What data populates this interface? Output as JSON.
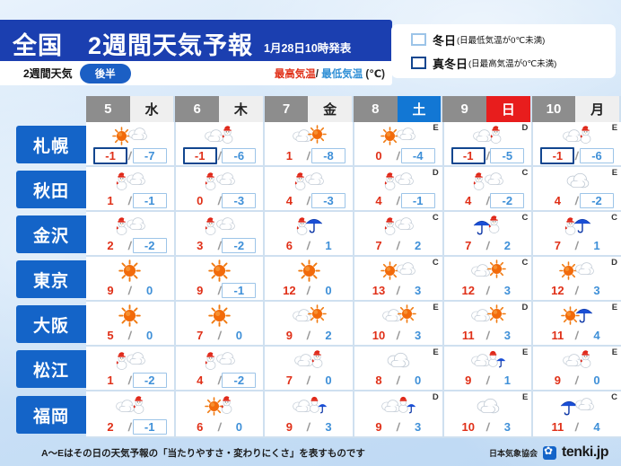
{
  "header": {
    "title": "全国　2週間天気予報",
    "published": "1月28日10時発表",
    "sub_label": "2週間天気",
    "period_pill": "後半",
    "temp_high_label": "最高気温",
    "temp_sep": "/",
    "temp_low_label": "最低気温",
    "temp_unit": "(℃)"
  },
  "legend": {
    "items": [
      {
        "name": "冬日",
        "note": "(日最低気温が0℃未満)",
        "swatch": "light",
        "color": "#9cc4e8"
      },
      {
        "name": "真冬日",
        "note": "(日最高気温が0℃未満)",
        "swatch": "dark",
        "color": "#12468f"
      }
    ]
  },
  "columns": [
    {
      "day": "5",
      "dow": "水",
      "dow_type": "weekday"
    },
    {
      "day": "6",
      "dow": "木",
      "dow_type": "weekday"
    },
    {
      "day": "7",
      "dow": "金",
      "dow_type": "weekday"
    },
    {
      "day": "8",
      "dow": "土",
      "dow_type": "sat"
    },
    {
      "day": "9",
      "dow": "日",
      "dow_type": "sun"
    },
    {
      "day": "10",
      "dow": "月",
      "dow_type": "weekday"
    }
  ],
  "rows": [
    {
      "city": "札幌",
      "cells": [
        {
          "icons": [
            "sun",
            "cloud"
          ],
          "high": "-1",
          "low": "-7",
          "rel": "",
          "high_box": "dark",
          "low_box": "light"
        },
        {
          "icons": [
            "cloud",
            "snow"
          ],
          "high": "-1",
          "low": "-6",
          "rel": "",
          "high_box": "dark",
          "low_box": "light"
        },
        {
          "icons": [
            "cloud",
            "sun"
          ],
          "high": "1",
          "low": "-8",
          "rel": "",
          "high_box": "none",
          "low_box": "light"
        },
        {
          "icons": [
            "sun",
            "cloud"
          ],
          "high": "0",
          "low": "-4",
          "rel": "E",
          "high_box": "none",
          "low_box": "light"
        },
        {
          "icons": [
            "cloud",
            "snow"
          ],
          "high": "-1",
          "low": "-5",
          "rel": "D",
          "high_box": "dark",
          "low_box": "light"
        },
        {
          "icons": [
            "cloud",
            "snow"
          ],
          "high": "-1",
          "low": "-6",
          "rel": "E",
          "high_box": "dark",
          "low_box": "light"
        }
      ]
    },
    {
      "city": "秋田",
      "cells": [
        {
          "icons": [
            "snow",
            "cloud"
          ],
          "high": "1",
          "low": "-1",
          "rel": "",
          "high_box": "none",
          "low_box": "light"
        },
        {
          "icons": [
            "snow",
            "cloud"
          ],
          "high": "0",
          "low": "-3",
          "rel": "",
          "high_box": "none",
          "low_box": "light"
        },
        {
          "icons": [
            "snow",
            "cloud"
          ],
          "high": "4",
          "low": "-3",
          "rel": "",
          "high_box": "none",
          "low_box": "light"
        },
        {
          "icons": [
            "snow",
            "cloud"
          ],
          "high": "4",
          "low": "-1",
          "rel": "D",
          "high_box": "none",
          "low_box": "light"
        },
        {
          "icons": [
            "snow",
            "cloud"
          ],
          "high": "4",
          "low": "-2",
          "rel": "C",
          "high_box": "none",
          "low_box": "light"
        },
        {
          "icons": [
            "cloud"
          ],
          "high": "4",
          "low": "-2",
          "rel": "E",
          "high_box": "none",
          "low_box": "light"
        }
      ]
    },
    {
      "city": "金沢",
      "cells": [
        {
          "icons": [
            "snow",
            "cloud"
          ],
          "high": "2",
          "low": "-2",
          "rel": "",
          "high_box": "none",
          "low_box": "light"
        },
        {
          "icons": [
            "snow",
            "cloud"
          ],
          "high": "3",
          "low": "-2",
          "rel": "",
          "high_box": "none",
          "low_box": "light"
        },
        {
          "icons": [
            "snow",
            "rain"
          ],
          "high": "6",
          "low": "1",
          "rel": "",
          "high_box": "none",
          "low_box": "none"
        },
        {
          "icons": [
            "snow",
            "cloud"
          ],
          "high": "7",
          "low": "2",
          "rel": "C",
          "high_box": "none",
          "low_box": "none"
        },
        {
          "icons": [
            "rain",
            "snow"
          ],
          "high": "7",
          "low": "2",
          "rel": "C",
          "high_box": "none",
          "low_box": "none"
        },
        {
          "icons": [
            "snow",
            "rain"
          ],
          "high": "7",
          "low": "1",
          "rel": "C",
          "high_box": "none",
          "low_box": "none"
        }
      ]
    },
    {
      "city": "東京",
      "cells": [
        {
          "icons": [
            "sun"
          ],
          "high": "9",
          "low": "0",
          "rel": "",
          "high_box": "none",
          "low_box": "none"
        },
        {
          "icons": [
            "sun"
          ],
          "high": "9",
          "low": "-1",
          "rel": "",
          "high_box": "none",
          "low_box": "light"
        },
        {
          "icons": [
            "sun"
          ],
          "high": "12",
          "low": "0",
          "rel": "",
          "high_box": "none",
          "low_box": "none"
        },
        {
          "icons": [
            "sun",
            "cloud"
          ],
          "high": "13",
          "low": "3",
          "rel": "C",
          "high_box": "none",
          "low_box": "none"
        },
        {
          "icons": [
            "cloud",
            "sun"
          ],
          "high": "12",
          "low": "3",
          "rel": "C",
          "high_box": "none",
          "low_box": "none"
        },
        {
          "icons": [
            "sun",
            "cloud"
          ],
          "high": "12",
          "low": "3",
          "rel": "D",
          "high_box": "none",
          "low_box": "none"
        }
      ]
    },
    {
      "city": "大阪",
      "cells": [
        {
          "icons": [
            "sun"
          ],
          "high": "5",
          "low": "0",
          "rel": "",
          "high_box": "none",
          "low_box": "none"
        },
        {
          "icons": [
            "sun"
          ],
          "high": "7",
          "low": "0",
          "rel": "",
          "high_box": "none",
          "low_box": "none"
        },
        {
          "icons": [
            "cloud",
            "sun"
          ],
          "high": "9",
          "low": "2",
          "rel": "",
          "high_box": "none",
          "low_box": "none"
        },
        {
          "icons": [
            "cloud",
            "sun"
          ],
          "high": "10",
          "low": "3",
          "rel": "E",
          "high_box": "none",
          "low_box": "none"
        },
        {
          "icons": [
            "cloud",
            "sun"
          ],
          "high": "11",
          "low": "3",
          "rel": "D",
          "high_box": "none",
          "low_box": "none"
        },
        {
          "icons": [
            "sun",
            "rain"
          ],
          "high": "11",
          "low": "4",
          "rel": "E",
          "high_box": "none",
          "low_box": "none"
        }
      ]
    },
    {
      "city": "松江",
      "cells": [
        {
          "icons": [
            "snow",
            "cloud"
          ],
          "high": "1",
          "low": "-2",
          "rel": "",
          "high_box": "none",
          "low_box": "light"
        },
        {
          "icons": [
            "snow",
            "cloud"
          ],
          "high": "4",
          "low": "-2",
          "rel": "",
          "high_box": "none",
          "low_box": "light"
        },
        {
          "icons": [
            "cloud",
            "snow"
          ],
          "high": "7",
          "low": "0",
          "rel": "",
          "high_box": "none",
          "low_box": "none"
        },
        {
          "icons": [
            "cloud"
          ],
          "high": "8",
          "low": "0",
          "rel": "E",
          "high_box": "none",
          "low_box": "none"
        },
        {
          "icons": [
            "cloud",
            "snowrain"
          ],
          "high": "9",
          "low": "1",
          "rel": "E",
          "high_box": "none",
          "low_box": "none"
        },
        {
          "icons": [
            "cloud",
            "snow"
          ],
          "high": "9",
          "low": "0",
          "rel": "E",
          "high_box": "none",
          "low_box": "none"
        }
      ]
    },
    {
      "city": "福岡",
      "cells": [
        {
          "icons": [
            "cloud",
            "snow"
          ],
          "high": "2",
          "low": "-1",
          "rel": "",
          "high_box": "none",
          "low_box": "light"
        },
        {
          "icons": [
            "sun",
            "snow"
          ],
          "high": "6",
          "low": "0",
          "rel": "",
          "high_box": "none",
          "low_box": "none"
        },
        {
          "icons": [
            "cloud",
            "snowrain"
          ],
          "high": "9",
          "low": "3",
          "rel": "",
          "high_box": "none",
          "low_box": "none"
        },
        {
          "icons": [
            "cloud",
            "snowrain"
          ],
          "high": "9",
          "low": "3",
          "rel": "D",
          "high_box": "none",
          "low_box": "none"
        },
        {
          "icons": [
            "cloud"
          ],
          "high": "10",
          "low": "3",
          "rel": "E",
          "high_box": "none",
          "low_box": "none"
        },
        {
          "icons": [
            "rain",
            "cloud"
          ],
          "high": "11",
          "low": "4",
          "rel": "C",
          "high_box": "none",
          "low_box": "none"
        }
      ]
    }
  ],
  "footer": {
    "note": "A〜Eはその日の天気予報の「当たりやすさ・変わりにくさ」を表すものです",
    "org": "日本気象協会",
    "logo_text": "tenki.jp"
  }
}
